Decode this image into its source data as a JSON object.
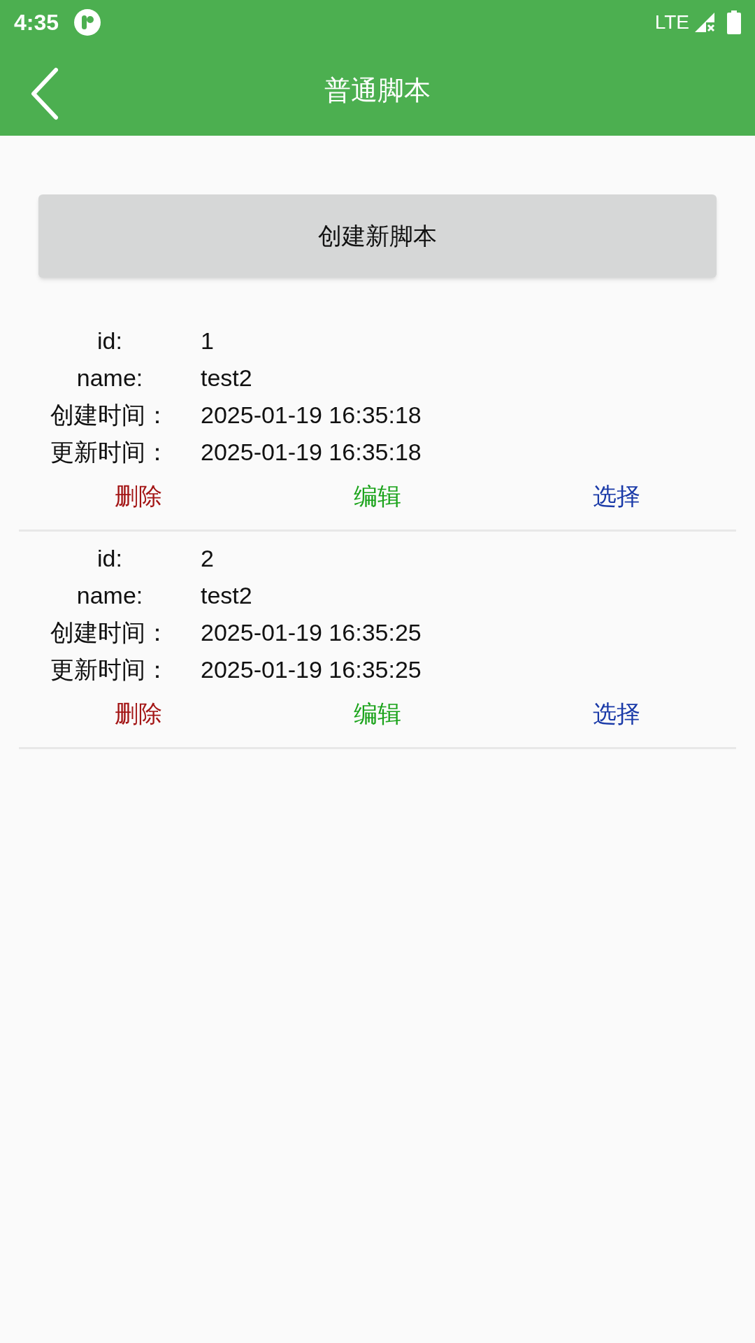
{
  "status_bar": {
    "time": "4:35",
    "network": "LTE"
  },
  "app_bar": {
    "title": "普通脚本"
  },
  "create_button": "创建新脚本",
  "scripts": [
    {
      "fields": [
        {
          "label": "id:",
          "value": "1"
        },
        {
          "label": "name:",
          "value": "test2"
        },
        {
          "label": "创建时间：",
          "value": "2025-01-19 16:35:18"
        },
        {
          "label": "更新时间：",
          "value": "2025-01-19 16:35:18"
        }
      ],
      "actions": [
        {
          "label": "删除",
          "color": "#a31515"
        },
        {
          "label": "编辑",
          "color": "#1aa31a"
        },
        {
          "label": "选择",
          "color": "#1a3aa8"
        }
      ]
    },
    {
      "fields": [
        {
          "label": "id:",
          "value": "2"
        },
        {
          "label": "name:",
          "value": "test2"
        },
        {
          "label": "创建时间：",
          "value": "2025-01-19 16:35:25"
        },
        {
          "label": "更新时间：",
          "value": "2025-01-19 16:35:25"
        }
      ],
      "actions": [
        {
          "label": "删除",
          "color": "#a31515"
        },
        {
          "label": "编辑",
          "color": "#1aa31a"
        },
        {
          "label": "选择",
          "color": "#1a3aa8"
        }
      ]
    }
  ]
}
